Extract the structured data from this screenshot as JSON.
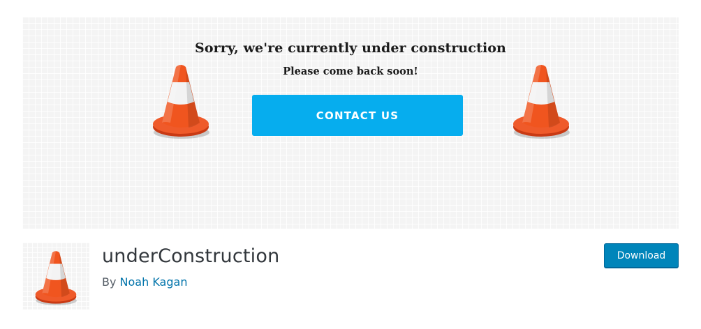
{
  "banner": {
    "heading": "Sorry, we're currently under construction",
    "subheading": "Please come back soon!",
    "contact_label": "CONTACT US",
    "contact_color": "#06adee",
    "cone_icon": "traffic-cone-icon"
  },
  "plugin": {
    "name": "underConstruction",
    "by_label": "By",
    "author": "Noah Kagan",
    "download_label": "Download",
    "download_color": "#0085ba",
    "link_color": "#0073aa"
  }
}
